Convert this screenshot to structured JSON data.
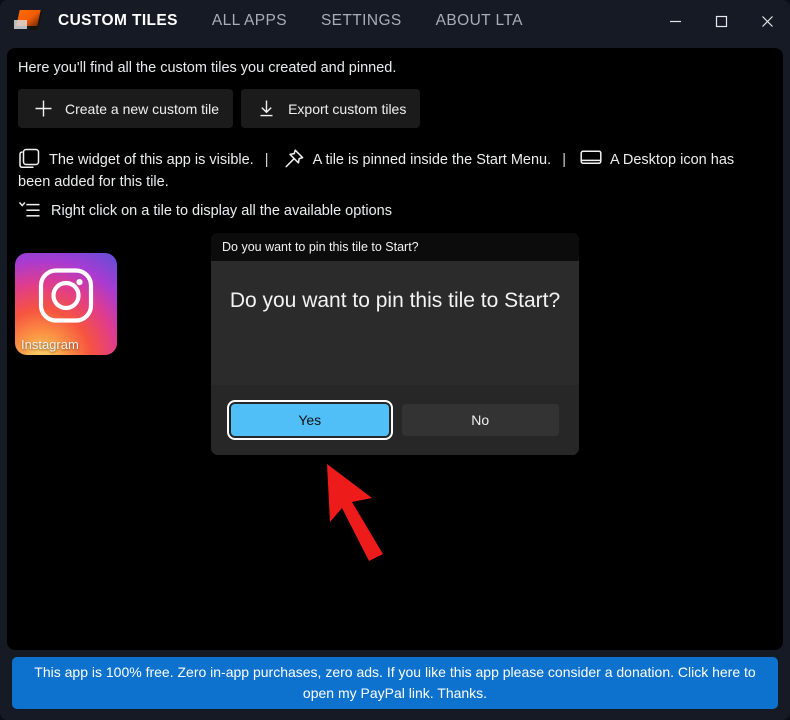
{
  "window": {
    "title": "CUSTOM TILES",
    "app_icon": "custom-tiles-logo",
    "caption": {
      "minimize": "Minimize",
      "maximize": "Maximize",
      "close": "Close"
    }
  },
  "nav": {
    "tabs": [
      {
        "label": "CUSTOM TILES",
        "active": true
      },
      {
        "label": "ALL APPS",
        "active": false
      },
      {
        "label": "SETTINGS",
        "active": false
      },
      {
        "label": "ABOUT LTA",
        "active": false
      }
    ]
  },
  "main": {
    "intro": "Here you'll find all the custom tiles you created and pinned.",
    "toolbar": {
      "create_label": "Create a new custom tile",
      "create_icon": "plus-icon",
      "export_label": "Export custom tiles",
      "export_icon": "download-icon"
    },
    "legend": {
      "widget": {
        "icon": "widget-icon",
        "text": "The widget of this app is visible."
      },
      "separator": "|",
      "pin": {
        "icon": "pin-icon",
        "text": "A tile is pinned inside the Start Menu."
      },
      "desktop": {
        "icon": "desktop-icon",
        "text": "A Desktop icon has been added for this tile."
      }
    },
    "hint": {
      "icon": "context-menu-icon",
      "text": "Right click on a tile to display all the available options"
    },
    "tiles": [
      {
        "name": "Instagram",
        "icon": "instagram-icon"
      }
    ]
  },
  "dialog": {
    "title": "Do you want to pin this tile to Start?",
    "message": "Do you want to pin this tile to Start?",
    "yes_label": "Yes",
    "no_label": "No",
    "focused_button": "Yes"
  },
  "banner": {
    "text": "This app is 100% free. Zero in-app purchases, zero ads. If you like this app please consider a donation. Click here to open my PayPal link. Thanks."
  },
  "cursor": {
    "icon": "arrow-pointer-annotation",
    "color": "#ee1b1b"
  },
  "colors": {
    "window_frame": "#151a24",
    "content_background": "#000000",
    "dialog_background": "#2b2b2b",
    "primary_button": "#50bff7",
    "banner_blue": "#0c72cd",
    "accent_orange": "#ff6a00"
  }
}
